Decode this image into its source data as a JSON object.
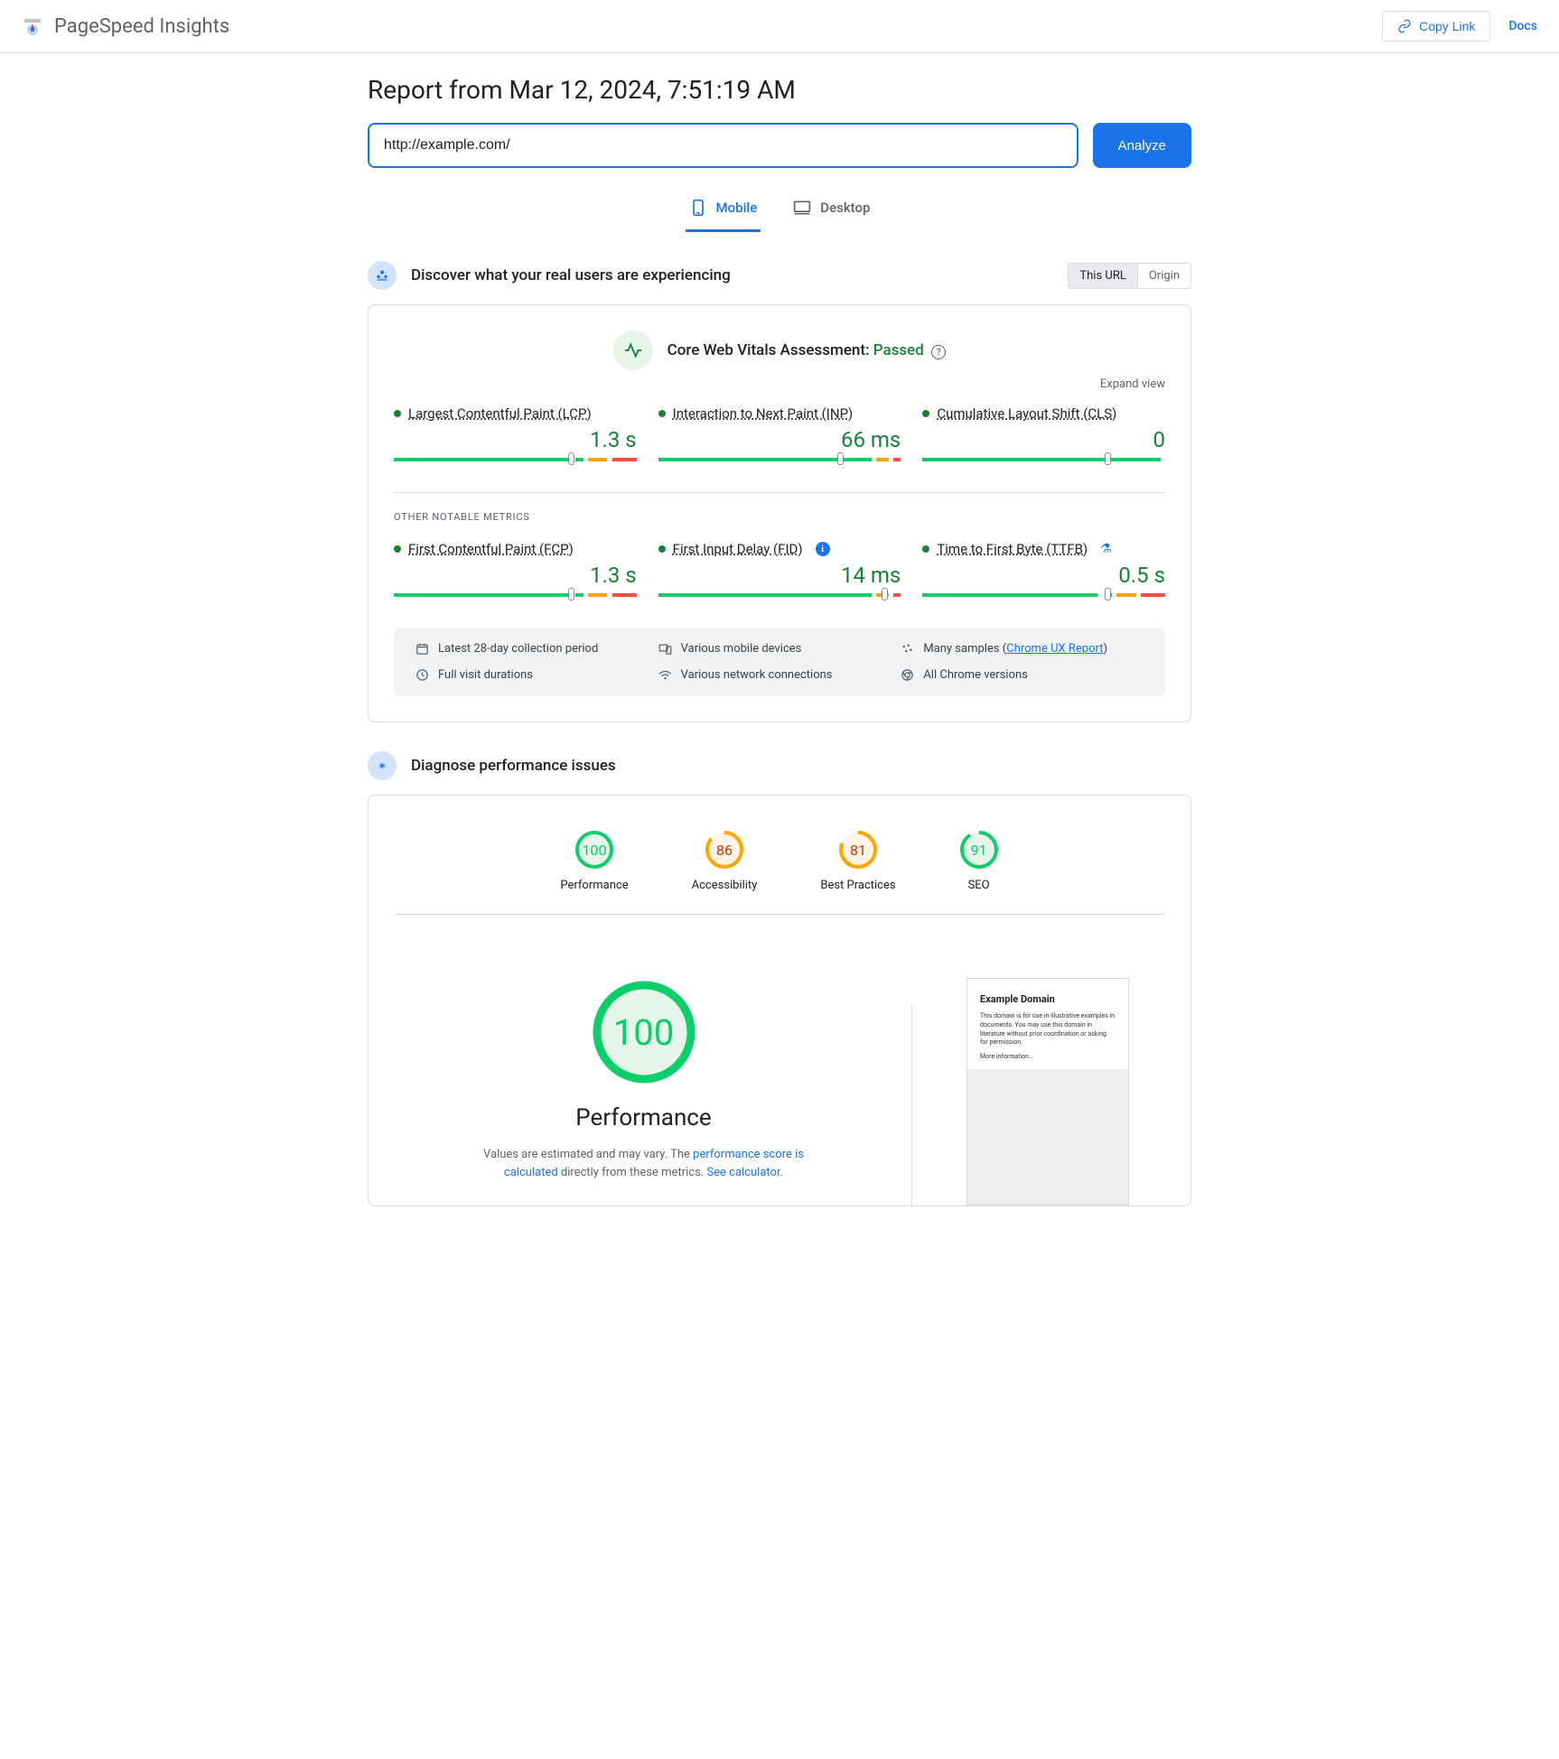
{
  "header": {
    "brand": "PageSpeed Insights",
    "copy_link": "Copy Link",
    "docs": "Docs"
  },
  "report": {
    "title": "Report from Mar 12, 2024, 7:51:19 AM",
    "url_value": "http://example.com/",
    "analyze": "Analyze"
  },
  "tabs": {
    "mobile": "Mobile",
    "desktop": "Desktop"
  },
  "discover": {
    "title": "Discover what your real users are experiencing",
    "toggle_url": "This URL",
    "toggle_origin": "Origin"
  },
  "cwv": {
    "label": "Core Web Vitals Assessment: ",
    "status": "Passed",
    "expand": "Expand view"
  },
  "metrics": {
    "lcp": {
      "name": "Largest Contentful Paint (LCP)",
      "value": "1.3 s",
      "green": 72,
      "orange": 10,
      "red": 10,
      "marker": 72
    },
    "inp": {
      "name": "Interaction to Next Paint (INP)",
      "value": "66 ms",
      "green": 74,
      "orange": 6,
      "red": 3,
      "marker": 74
    },
    "cls": {
      "name": "Cumulative Layout Shift (CLS)",
      "value": "0",
      "green": 75,
      "orange": 0,
      "red": 0,
      "marker": 75
    },
    "other_label": "OTHER NOTABLE METRICS",
    "fcp": {
      "name": "First Contentful Paint (FCP)",
      "value": "1.3 s",
      "green": 72,
      "orange": 8,
      "red": 12,
      "marker": 72
    },
    "fid": {
      "name": "First Input Delay (FID)",
      "value": "14 ms",
      "green": 92,
      "orange": 5,
      "red": 2,
      "marker": 92
    },
    "ttfb": {
      "name": "Time to First Byte (TTFB)",
      "value": "0.5 s",
      "green": 75,
      "orange": 8,
      "red": 12,
      "marker": 75
    }
  },
  "footer_info": {
    "period": "Latest 28-day collection period",
    "devices": "Various mobile devices",
    "samples_prefix": "Many samples (",
    "samples_link": "Chrome UX Report",
    "samples_suffix": ")",
    "duration": "Full visit durations",
    "network": "Various network connections",
    "chrome": "All Chrome versions"
  },
  "diagnose": {
    "title": "Diagnose performance issues"
  },
  "scores": {
    "performance": {
      "label": "Performance",
      "value": "100",
      "color": "#0cce6b",
      "bg": "#e6f4ea",
      "pct": 100
    },
    "accessibility": {
      "label": "Accessibility",
      "value": "86",
      "color": "#ffa400",
      "bg": "#fff4e5",
      "pct": 86
    },
    "best_practices": {
      "label": "Best Practices",
      "value": "81",
      "color": "#ffa400",
      "bg": "#fff4e5",
      "pct": 81
    },
    "seo": {
      "label": "SEO",
      "value": "91",
      "color": "#0cce6b",
      "bg": "#e6f4ea",
      "pct": 91
    }
  },
  "perf_detail": {
    "score": "100",
    "heading": "Performance",
    "desc1": "Values are estimated and may vary. The ",
    "link1": "performance score is calculated",
    "desc2": " directly from these metrics. ",
    "link2": "See calculator."
  },
  "preview": {
    "title": "Example Domain",
    "body": "This domain is for use in illustrative examples in documents. You may use this domain in literature without prior coordination or asking for permission.",
    "more": "More information..."
  }
}
